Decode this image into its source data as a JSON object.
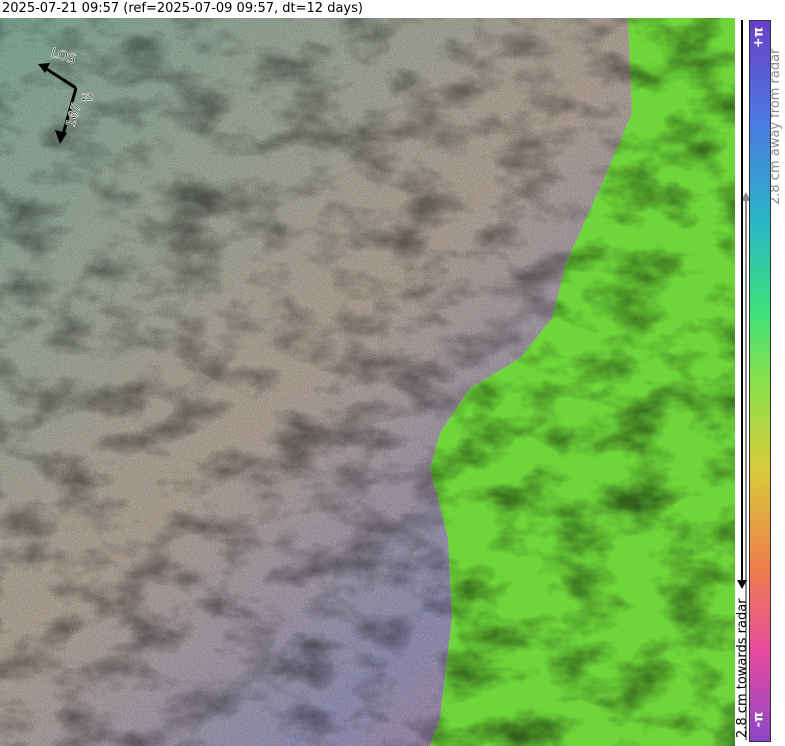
{
  "header": {
    "title": "2025-07-21 09:57 (ref=2025-07-09 09:57, dt=12 days)"
  },
  "map": {
    "compass": {
      "los_label": "LOS",
      "heading_label": "167",
      "north_label": "N"
    }
  },
  "colorbar": {
    "top_label": "+π",
    "bottom_label": "-π",
    "away_label": "2.8 cm away from radar",
    "towards_label": "2.8 cm towards radar",
    "colors": [
      "#6a3ec8",
      "#4a7ae0",
      "#2ab6c8",
      "#3ce07c",
      "#86e04a",
      "#d6cc3a",
      "#f07e4c",
      "#e64aa0",
      "#8a46c8"
    ]
  },
  "colors": {
    "terrain_green": "#6ed63a",
    "interferogram_base": "#7a6e72"
  }
}
